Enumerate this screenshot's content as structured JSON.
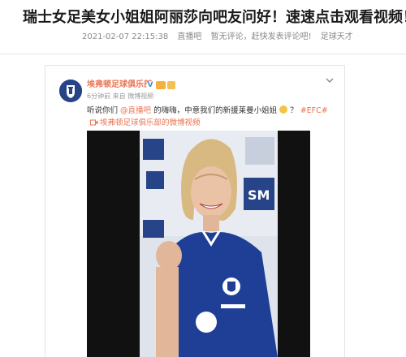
{
  "article": {
    "title": "瑞士女足美女小姐姐阿丽莎向吧友问好！速速点击观看视频！",
    "date": "2021-02-07 22:15:38",
    "source": "直播吧",
    "comments": "暂无评论，赶快发表评论吧!",
    "category": "足球天才"
  },
  "post": {
    "account_name": "埃弗顿足球俱乐部",
    "time": "6分钟前",
    "via_prefix": "来自",
    "via": "微博视频",
    "text_lead": "听说你们",
    "mention": "@直播吧",
    "text_mid": "的嗨嗨，中意我们的新援莱曼小姐姐",
    "text_after_emoji": "？",
    "hashtag": "#EFC#",
    "link_text": "埃弗顿足球俱乐部的微博视频"
  },
  "video": {
    "sponsor_text": "SM"
  },
  "colors": {
    "accent": "#eb7350",
    "everton_blue": "#274488"
  },
  "icons": {
    "avatar": "everton-crest-icon",
    "verified": "verified-icon",
    "expand": "chevron-down-icon",
    "video_link": "video-camera-icon"
  }
}
